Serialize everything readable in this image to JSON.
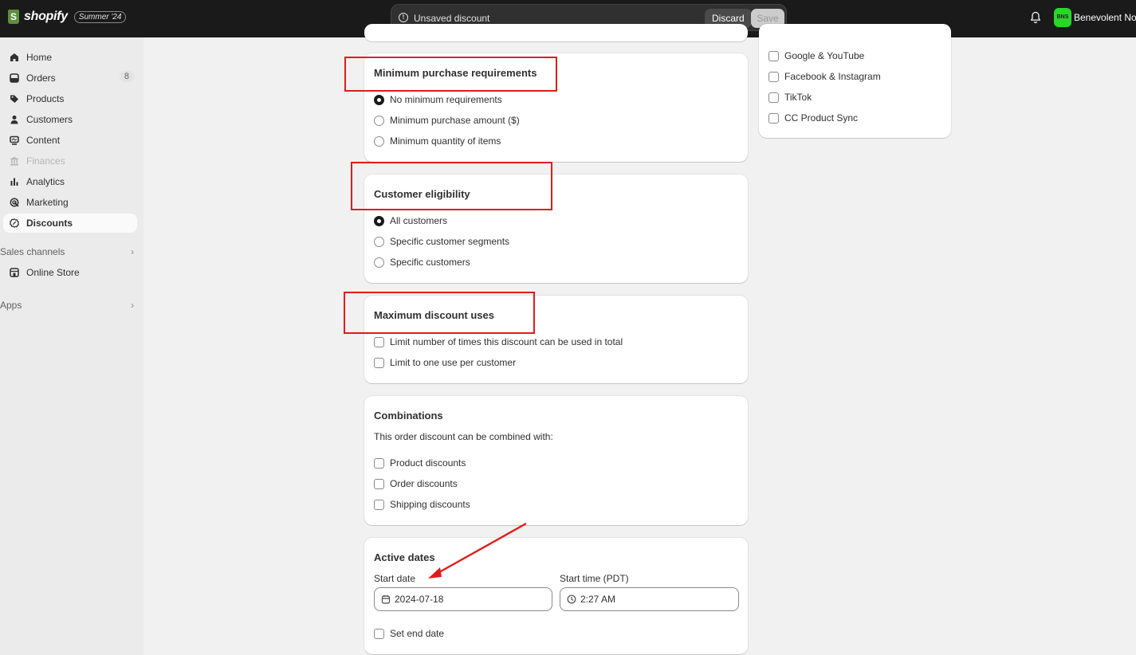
{
  "topbar": {
    "brand": "shopify",
    "edition": "Summer '24",
    "unsaved_text": "Unsaved discount",
    "discard_label": "Discard",
    "save_label": "Save",
    "avatar_initials": "BNS",
    "store_name": "Benevolent Nour"
  },
  "sidebar": {
    "items": [
      {
        "label": "Home",
        "icon": "home-icon"
      },
      {
        "label": "Orders",
        "icon": "orders-icon",
        "badge": "8"
      },
      {
        "label": "Products",
        "icon": "tag-icon"
      },
      {
        "label": "Customers",
        "icon": "person-icon"
      },
      {
        "label": "Content",
        "icon": "content-icon"
      },
      {
        "label": "Finances",
        "icon": "bank-icon",
        "disabled": true
      },
      {
        "label": "Analytics",
        "icon": "bar-chart-icon"
      },
      {
        "label": "Marketing",
        "icon": "target-icon"
      },
      {
        "label": "Discounts",
        "icon": "discount-icon",
        "active": true
      }
    ],
    "sales_channels_label": "Sales channels",
    "online_store_label": "Online Store",
    "apps_label": "Apps"
  },
  "channels": {
    "items": [
      "Google & YouTube",
      "Facebook & Instagram",
      "TikTok",
      "CC Product Sync"
    ]
  },
  "min_purchase": {
    "title": "Minimum purchase requirements",
    "options": [
      "No minimum requirements",
      "Minimum purchase amount ($)",
      "Minimum quantity of items"
    ],
    "selected_index": 0
  },
  "eligibility": {
    "title": "Customer eligibility",
    "options": [
      "All customers",
      "Specific customer segments",
      "Specific customers"
    ],
    "selected_index": 0
  },
  "max_uses": {
    "title": "Maximum discount uses",
    "options": [
      "Limit number of times this discount can be used in total",
      "Limit to one use per customer"
    ]
  },
  "combinations": {
    "title": "Combinations",
    "subtitle": "This order discount can be combined with:",
    "options": [
      "Product discounts",
      "Order discounts",
      "Shipping discounts"
    ]
  },
  "active_dates": {
    "title": "Active dates",
    "start_date_label": "Start date",
    "start_date_value": "2024-07-18",
    "start_time_label": "Start time (PDT)",
    "start_time_value": "2:27 AM",
    "end_date_label": "Set end date"
  },
  "colors": {
    "annotation": "#e01b1b",
    "topbar": "#1a1a1a",
    "avatar": "#29d629"
  }
}
